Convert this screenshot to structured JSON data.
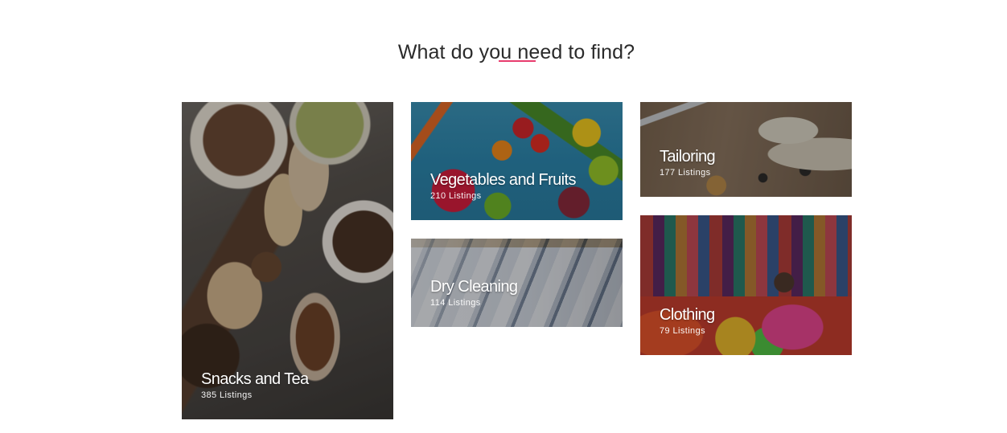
{
  "section": {
    "title": "What do you need to find?"
  },
  "colors": {
    "accent": "#e83c6e",
    "title": "#2a2a2a",
    "card_text": "#ffffff"
  },
  "categories": [
    {
      "name": "Snacks and Tea",
      "count": "385 Listings",
      "image": "snacks-and-tea-image"
    },
    {
      "name": "Vegetables and Fruits",
      "count": "210 Listings",
      "image": "vegetables-and-fruits-image"
    },
    {
      "name": "Dry Cleaning",
      "count": "114 Listings",
      "image": "dry-cleaning-image"
    },
    {
      "name": "Tailoring",
      "count": "177 Listings",
      "image": "tailoring-image"
    },
    {
      "name": "Clothing",
      "count": "79 Listings",
      "image": "clothing-image"
    }
  ]
}
